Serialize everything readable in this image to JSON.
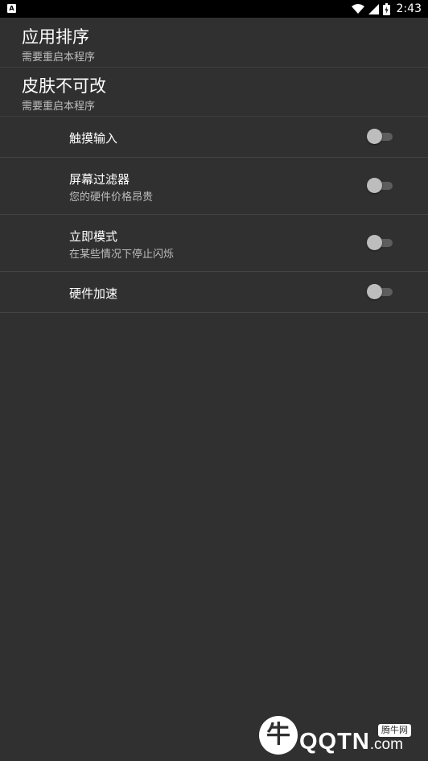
{
  "status_bar": {
    "notification_icon": "A",
    "time": "2:43",
    "icons": [
      "wifi-icon",
      "signal-icon",
      "battery-icon"
    ]
  },
  "prefs_top": [
    {
      "title": "应用排序",
      "summary": "需要重启本程序"
    },
    {
      "title": "皮肤不可改",
      "summary": "需要重启本程序"
    }
  ],
  "prefs_switches": [
    {
      "title": "触摸输入",
      "summary": "",
      "enabled": false
    },
    {
      "title": "屏幕过滤器",
      "summary": "您的硬件价格昂贵",
      "enabled": false
    },
    {
      "title": "立即模式",
      "summary": "在某些情况下停止闪烁",
      "enabled": false
    },
    {
      "title": "硬件加速",
      "summary": "",
      "enabled": false
    }
  ],
  "watermark": {
    "logo_glyph": "牛",
    "text": "QQTN",
    "suffix": ".com",
    "badge": "腾牛网"
  },
  "colors": {
    "background": "#303030",
    "status_bar": "#000000",
    "divider": "#444444",
    "switch_thumb_off": "#bdbdbd",
    "switch_track_off": "#5d5d5d"
  }
}
